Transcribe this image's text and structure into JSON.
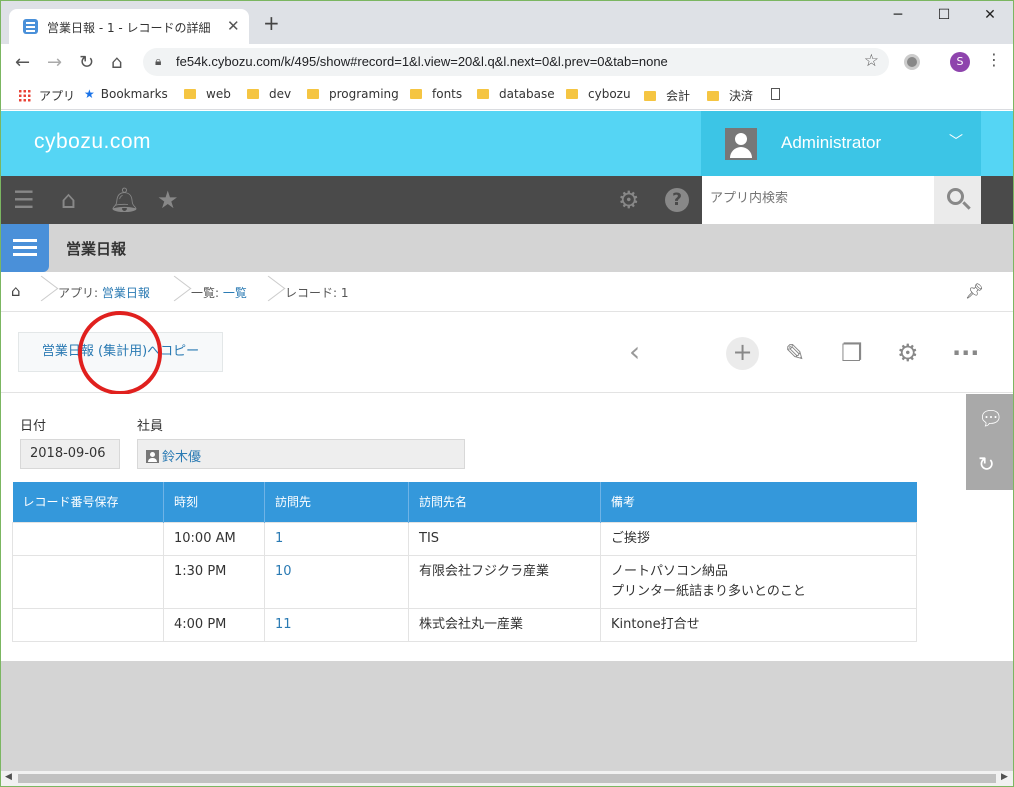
{
  "browser": {
    "tab_title": "営業日報 - 1 - レコードの詳細",
    "new_tab": "+",
    "url": "fe54k.cybozu.com/k/495/show#record=1&l.view=20&l.q&l.next=0&l.prev=0&tab=none",
    "profile_initial": "S",
    "bookmarks": [
      "アプリ",
      "Bookmarks",
      "web",
      "dev",
      "programing",
      "fonts",
      "database",
      "cybozu",
      "会計",
      "決済"
    ]
  },
  "header": {
    "logo": "cybozu.com",
    "user_name": "Administrator"
  },
  "toolbar": {
    "search_placeholder": "アプリ内検索"
  },
  "app": {
    "title": "営業日報"
  },
  "breadcrumb": {
    "app_prefix": "アプリ: ",
    "app_name": "営業日報",
    "list_prefix": "一覧: ",
    "list_name": "一覧",
    "record": "レコード: 1"
  },
  "actions": {
    "copy_button": "営業日報 (集計用)へコピー"
  },
  "record": {
    "date_label": "日付",
    "date_value": "2018-09-06",
    "employee_label": "社員",
    "employee_value": "鈴木優"
  },
  "table": {
    "headers": [
      "レコード番号保存",
      "時刻",
      "訪問先",
      "訪問先名",
      "備考"
    ],
    "rows": [
      {
        "record_no": "",
        "time": "10:00 AM",
        "visit": "1",
        "visit_name": "TIS",
        "note1": "ご挨拶",
        "note2": ""
      },
      {
        "record_no": "",
        "time": "1:30 PM",
        "visit": "10",
        "visit_name": "有限会社フジクラ産業",
        "note1": "ノートパソコン納品",
        "note2": "プリンター紙詰まり多いとのこと"
      },
      {
        "record_no": "",
        "time": "4:00 PM",
        "visit": "11",
        "visit_name": "株式会社丸一産業",
        "note1": "Kintone打合せ",
        "note2": ""
      }
    ]
  },
  "colors": {
    "header_bg": "#55d5f4",
    "toolbar_bg": "#4a4a4a",
    "table_header": "#3498db",
    "link": "#2a7ab3",
    "highlight_circle": "#e0201e"
  }
}
